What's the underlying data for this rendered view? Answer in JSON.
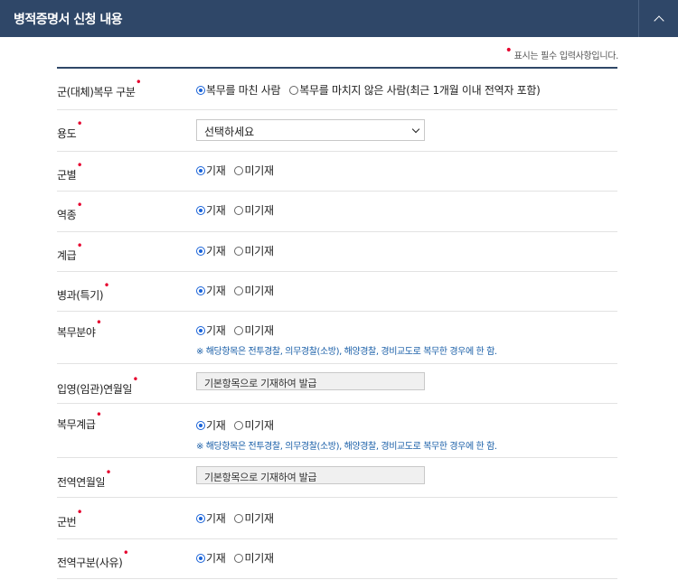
{
  "header": {
    "title": "병적증명서 신청 내용"
  },
  "required_note": {
    "text": "표시는 필수 입력사항입니다."
  },
  "fields": {
    "service_type": {
      "label": "군(대체)복무 구분",
      "options": [
        "복무를 마친 사람",
        "복무를 마치지 않은 사람(최근 1개월 이내 전역자 포함)"
      ],
      "selected": 0
    },
    "purpose": {
      "label": "용도",
      "value": "선택하세요"
    },
    "branch": {
      "label": "군별",
      "options": [
        "기재",
        "미기재"
      ],
      "selected": 0
    },
    "service_category": {
      "label": "역종",
      "options": [
        "기재",
        "미기재"
      ],
      "selected": 0
    },
    "rank": {
      "label": "계급",
      "options": [
        "기재",
        "미기재"
      ],
      "selected": 0
    },
    "specialty": {
      "label": "병과(특기)",
      "options": [
        "기재",
        "미기재"
      ],
      "selected": 0
    },
    "service_field": {
      "label": "복무분야",
      "options": [
        "기재",
        "미기재"
      ],
      "selected": 0,
      "note": "※ 해당항목은 전투경찰, 의무경찰(소방), 해양경찰, 경비교도로 복무한 경우에 한 함."
    },
    "enlistment_date": {
      "label": "입영(임관)연월일",
      "value": "기본항목으로 기재하여 발급"
    },
    "service_rank": {
      "label": "복무계급",
      "options": [
        "기재",
        "미기재"
      ],
      "selected": 0,
      "note": "※ 해당항목은 전투경찰, 의무경찰(소방), 해양경찰, 경비교도로 복무한 경우에 한 함."
    },
    "discharge_date": {
      "label": "전역연월일",
      "value": "기본항목으로 기재하여 발급"
    },
    "service_number": {
      "label": "군번",
      "options": [
        "기재",
        "미기재"
      ],
      "selected": 0
    },
    "discharge_reason": {
      "label": "전역구분(사유)",
      "options": [
        "기재",
        "미기재"
      ],
      "selected": 0
    }
  }
}
